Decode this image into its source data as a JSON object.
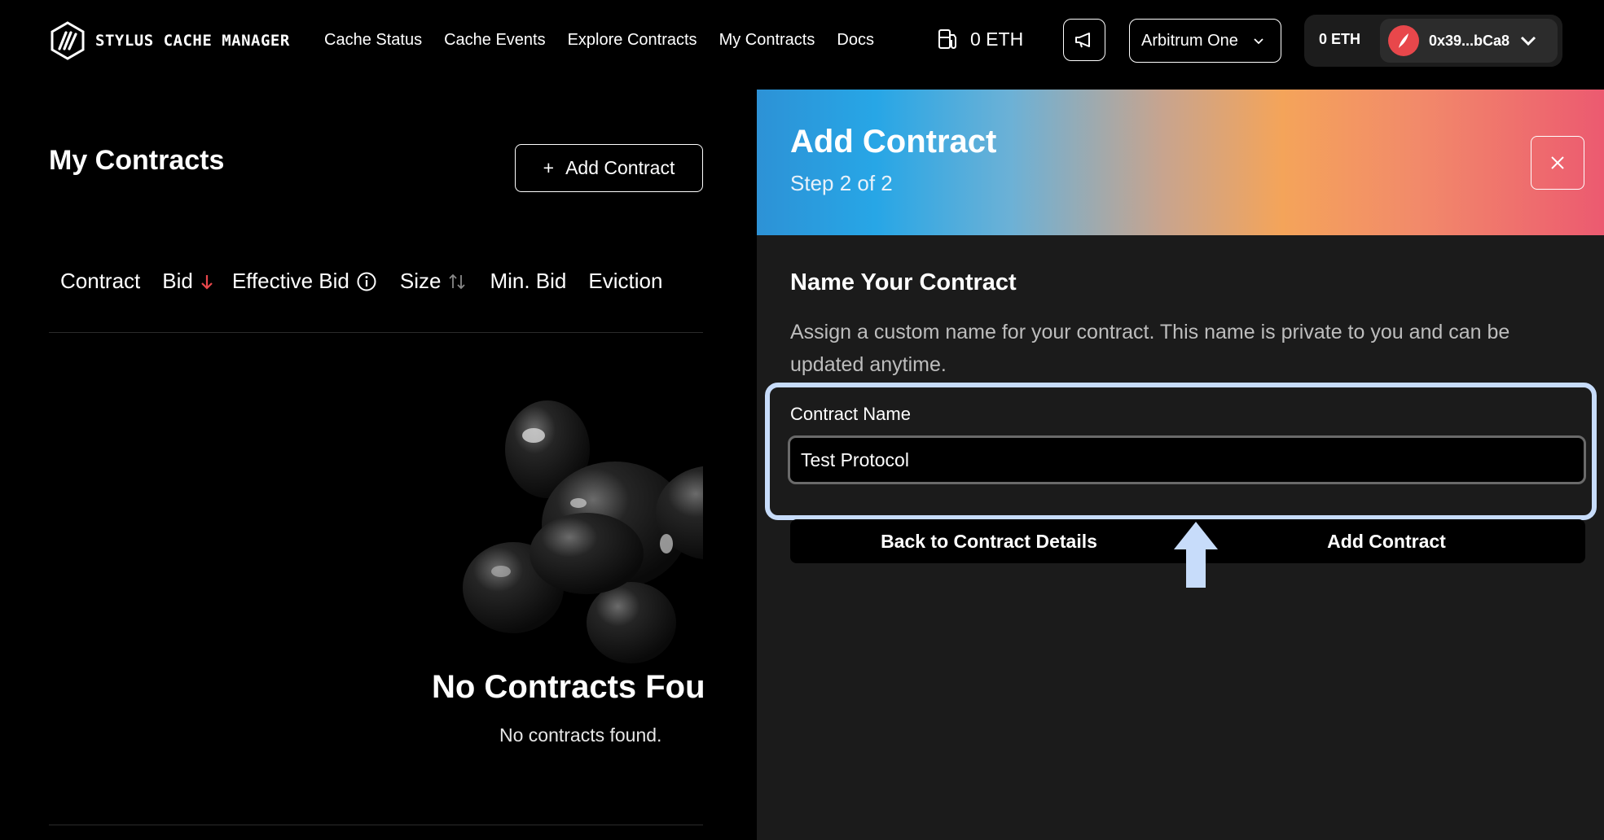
{
  "header": {
    "logo_text": "STYLUS CACHE MANAGER",
    "nav": [
      "Cache Status",
      "Cache Events",
      "Explore Contracts",
      "My Contracts",
      "Docs"
    ],
    "gas_value": "0 ETH",
    "network": "Arbitrum One",
    "wallet_balance": "0 ETH",
    "wallet_address": "0x39...bCa8"
  },
  "page": {
    "title": "My Contracts",
    "add_button": "Add Contract",
    "add_button_prefix": "+",
    "columns": [
      "Contract",
      "Bid",
      "Effective Bid",
      "Size",
      "Min. Bid",
      "Eviction"
    ],
    "empty_title": "No Contracts Found",
    "empty_subtitle": "No contracts found."
  },
  "drawer": {
    "title": "Add Contract",
    "step": "Step 2 of 2",
    "section_title": "Name Your Contract",
    "section_desc": "Assign a custom name for your contract. This name is private to you and can be updated anytime.",
    "field_label": "Contract Name",
    "field_value": "Test Protocol",
    "back_button": "Back to Contract Details",
    "submit_button": "Add Contract"
  },
  "colors": {
    "accent_sort": "#e8474b",
    "highlight": "#c7dcfa",
    "drawer_bg": "#1b1b1b"
  }
}
